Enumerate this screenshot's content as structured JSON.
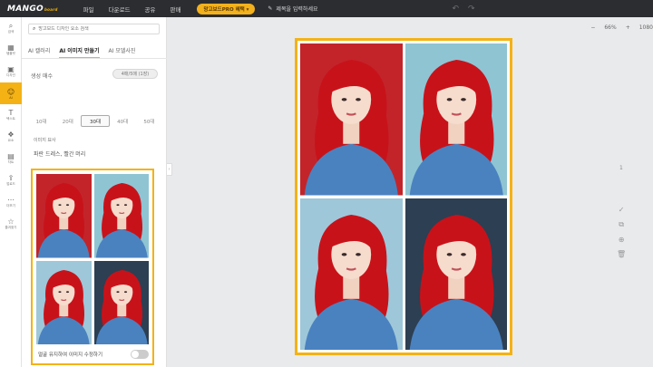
{
  "topbar": {
    "logo": "MANGO",
    "logo_sub": "board",
    "menu": [
      "파일",
      "다운로드",
      "공유",
      "판매"
    ],
    "crown_button": "망고보드PRO 혜택 ▾",
    "title_placeholder": "제목을 입력하세요"
  },
  "rail": [
    {
      "label": "검색",
      "icon": "search-icon"
    },
    {
      "label": "템플릿",
      "icon": "template-icon"
    },
    {
      "label": "디자인",
      "icon": "design-icon"
    },
    {
      "label": "AI",
      "icon": "ai-icon"
    },
    {
      "label": "텍스트",
      "icon": "text-icon"
    },
    {
      "label": "요소",
      "icon": "element-icon"
    },
    {
      "label": "차트",
      "icon": "chart-icon"
    },
    {
      "label": "업로드",
      "icon": "upload-icon"
    },
    {
      "label": "더보기",
      "icon": "more-icon"
    },
    {
      "label": "즐겨찾기",
      "icon": "star-icon"
    }
  ],
  "panel": {
    "search_placeholder": "망고보드 디자인 요소 검색",
    "tabs": [
      "AI 캘러리",
      "AI 이미지 만들기",
      "AI 모델사진"
    ],
    "count_label": "생성 매수",
    "count_pill": "4매/5매 (1장)",
    "ages": [
      "10대",
      "20대",
      "30대",
      "40대",
      "50대"
    ],
    "selected_age": "30대",
    "desc_label": "이미지 묘사",
    "desc_text": "파란 드레스, 빨간 머리",
    "toggle_label": "얼굴 유지하여 이미지 수정하기"
  },
  "editor": {
    "zoom": "66%",
    "zoom_minus": "−",
    "zoom_plus": "+",
    "width": "1080",
    "page_number": "1"
  },
  "colors": {
    "accent": "#f4b215",
    "topbar": "#2b2d31",
    "dress": "#4a82c0",
    "hair": "#c8121a"
  }
}
